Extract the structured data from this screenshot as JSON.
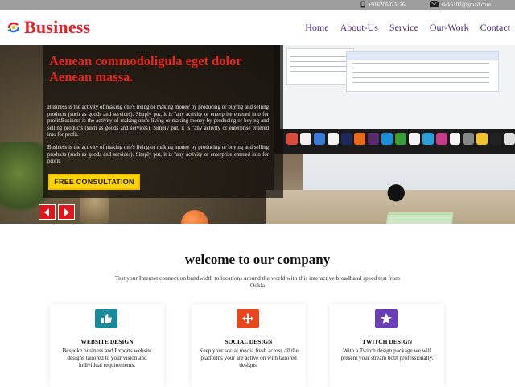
{
  "topbar": {
    "phone": "+916206823126",
    "email": "sick5102@gmail.com",
    "phone_icon": "phone-icon",
    "email_icon": "mail-icon"
  },
  "header": {
    "brand": "Business",
    "nav": [
      "Home",
      "About-Us",
      "Service",
      "Our-Work",
      "Contact"
    ]
  },
  "hero": {
    "heading": "Aenean commodoligula eget dolor Aenean massa.",
    "para1": "Business is the activity of making one's living or making money by producing or buying and selling products (such as goods and services). Simply put, it is \"any activity or enterprise entered into for profit.Business is the activity of making one's living or making money by producing or buying and selling products (such as goods and services). Simply put, it is \"any activity or enterprise entered into for profit.",
    "para2": "Business is the activity of making one's living or making money by producing or buying and selling products (such as goods and services). Simply put, it is \"any activity or enterprise entered into for profit.",
    "cta": "FREE CONSULTATION",
    "prev_icon": "chevron-left-icon",
    "next_icon": "chevron-right-icon"
  },
  "welcome": {
    "title": "welcome to our company",
    "subtitle": "Test your Internet connection bandwidth to locations around the world with this interactive broadband speed test from Ookla"
  },
  "services": [
    {
      "title": "WEBSITE DESIGN",
      "desc": "Bespoke business and Exports website designs tailored to your vision and individual requirements.",
      "icon": "thumbs-up-icon",
      "color": "#1a8a9a"
    },
    {
      "title": "SOCIAL DESIGN",
      "desc": "Keep your social media fresh across all the platforms your are active on with tailored designs.",
      "icon": "move-arrows-icon",
      "color": "#e8461e"
    },
    {
      "title": "TWITCH DESIGN",
      "desc": "With a Twitch design package we will present your stream both professionally.",
      "icon": "star-icon",
      "color": "#6a3fb5"
    }
  ]
}
